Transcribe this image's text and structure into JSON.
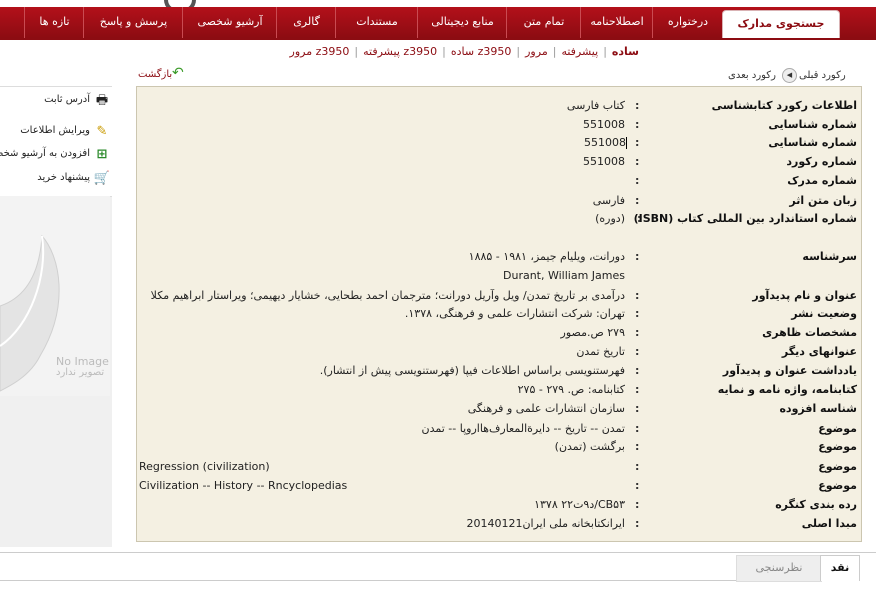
{
  "nav": {
    "tabs": [
      {
        "label": "جستجوی مدارک",
        "active": true
      },
      {
        "label": "درختواره"
      },
      {
        "label": "اصطلاحنامه"
      },
      {
        "label": "تمام متن"
      },
      {
        "label": "منابع دیجیتالی"
      },
      {
        "label": "مستندات"
      },
      {
        "label": "گالری"
      },
      {
        "label": "آرشیو شخصی"
      },
      {
        "label": "پرسش و پاسخ"
      },
      {
        "label": "تازه ها"
      }
    ]
  },
  "subnav": {
    "items": [
      {
        "label": "ساده",
        "active": true
      },
      {
        "label": "پیشرفته"
      },
      {
        "label": "مرور"
      },
      {
        "label": "z3950 ساده"
      },
      {
        "label": "z3950 پیشرفته"
      },
      {
        "label": "z3950 مرور"
      }
    ]
  },
  "record_nav": {
    "prev": "رکورد قبلی",
    "next": "رکورد بعدی",
    "back": "بازگشت"
  },
  "sidebar": {
    "items": [
      {
        "label": "آدرس ثابت",
        "icon": "printer-icon"
      },
      {
        "label": "ویرایش اطلاعات",
        "icon": "edit-icon"
      },
      {
        "label": "افزودن به آرشیو شخصی",
        "icon": "add-archive-icon"
      },
      {
        "label": "پیشنهاد خرید",
        "icon": "cart-icon"
      }
    ],
    "no_image_en": "No Image",
    "no_image_fa": "تصویر ندارد"
  },
  "record": {
    "rows": [
      {
        "label": "اطلاعات رکورد کتابشناسی",
        "value": "کتاب فارسی"
      },
      {
        "label": "شماره شناسایی",
        "value": "551008"
      },
      {
        "label": "شماره شناسایی",
        "value": "551008"
      },
      {
        "label": "شماره رکورد",
        "value": "551008"
      },
      {
        "label": "شماره مدرک",
        "value": ""
      },
      {
        "label": "زبان متن اثر",
        "value": "فارسی"
      },
      {
        "label": "شماره استاندارد بین المللی کتاب (ISBN)",
        "value": "(دوره)"
      },
      {
        "label": "سرشناسه",
        "value": "دورانت، ویلیام جیمز، ۱۹۸۱ - ۱۸۸۵"
      },
      {
        "label": "",
        "value": "Durant, William James"
      },
      {
        "label": "عنوان و نام پدیدآور",
        "value": "درآمدی بر تاریخ تمدن/ ویل وآریل دورانت؛ مترجمان احمد بطحایی، خشایار دیهیمی؛ ویراستار ابراهیم مکلا"
      },
      {
        "label": "وضعیت نشر",
        "value": "تهران: شرکت انتشارات علمی و فرهنگی، ۱۳۷۸."
      },
      {
        "label": "مشخصات ظاهری",
        "value": "۲۷۹ ص.مصور"
      },
      {
        "label": "عنوانهای دیگر",
        "value": "تاریخ تمدن"
      },
      {
        "label": "یادداشت عنوان و پدیدآور",
        "value": "فهرستنویسی براساس اطلاعات فیپا (فهرستنویسی پیش از انتشار)."
      },
      {
        "label": "کتابنامه، واژه نامه و نمایه",
        "value": "کتابنامه: ص. ۲۷۹ - ۲۷۵"
      },
      {
        "label": "شناسه افزوده",
        "value": "سازمان انتشارات علمی و فرهنگی"
      },
      {
        "label": "موضوع",
        "value": "تمدن -- تاریخ -- دایرةالمعارف‌هااروپا -- تمدن"
      },
      {
        "label": "موضوع",
        "value": "برگشت (تمدن)"
      },
      {
        "label": "موضوع",
        "value": "Regression (civilization)"
      },
      {
        "label": "موضوع",
        "value": "Civilization -- History -- Rncyclopedias"
      },
      {
        "label": "رده بندی کنگره",
        "value": "CB۵۳/د۹‌‌ت۲۲ ۱۳۷۸"
      },
      {
        "label": "مبدا اصلی",
        "value": "ایرانکتابخانه ملی ایران20140121"
      }
    ]
  },
  "bottom_tabs": {
    "active": "نقد",
    "inactive": "نظرسنجی"
  }
}
